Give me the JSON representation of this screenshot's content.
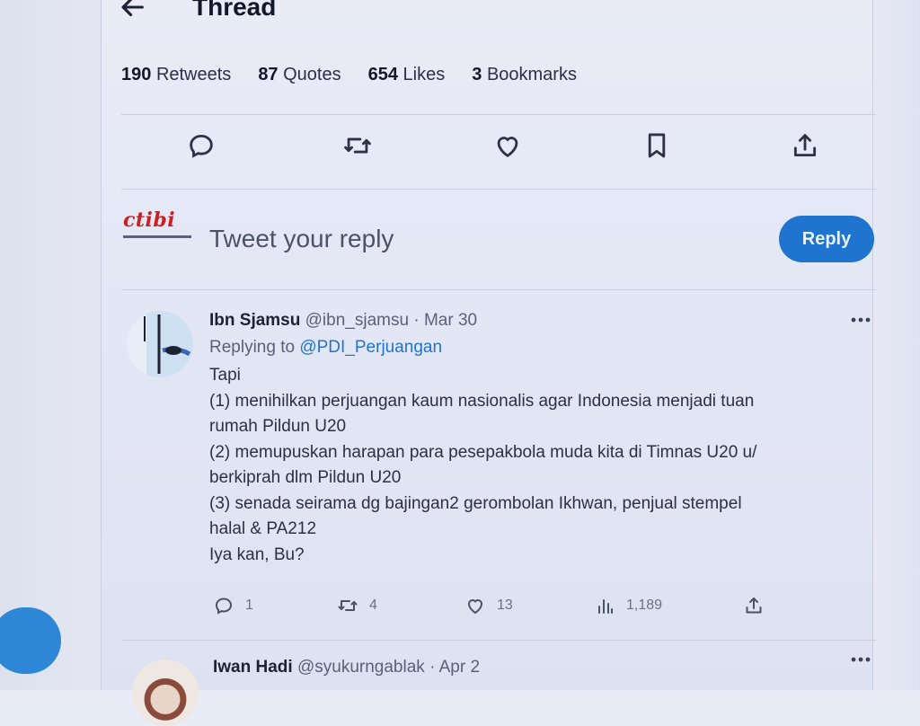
{
  "header": {
    "title": "Thread"
  },
  "stats": [
    {
      "count": "190",
      "label": "Retweets"
    },
    {
      "count": "87",
      "label": "Quotes"
    },
    {
      "count": "654",
      "label": "Likes"
    },
    {
      "count": "3",
      "label": "Bookmarks"
    }
  ],
  "actions": [
    "reply-icon",
    "retweet-icon",
    "like-icon",
    "bookmark-icon",
    "share-icon"
  ],
  "compose": {
    "logo_text": "ctibi",
    "placeholder": "Tweet your reply",
    "reply_label": "Reply"
  },
  "tweet": {
    "author": "Ibn Sjamsu",
    "handle": "@ibn_sjamsu",
    "date": "Mar 30",
    "replying_prefix": "Replying to",
    "replying_to": "@PDI_Perjuangan",
    "text": "Tapi\n(1) menihilkan perjuangan kaum nasionalis agar Indonesia menjadi tuan\nrumah Pildun U20\n(2) memupuskan harapan para pesepakbola muda kita di Timnas U20 u/\nberkiprah dlm Pildun U20\n(3) senada seirama dg bajingan2 gerombolan Ikhwan, penjual stempel\nhalal & PA212\nIya kan, Bu?",
    "replies": "1",
    "retweets": "4",
    "likes": "13",
    "views": "1,189"
  },
  "tweet2": {
    "author": "Iwan Hadi",
    "handle": "@syukurngablak",
    "date": "Apr 2"
  },
  "colors": {
    "accent": "#1f74cf",
    "logo_red": "#cc1f1f"
  }
}
